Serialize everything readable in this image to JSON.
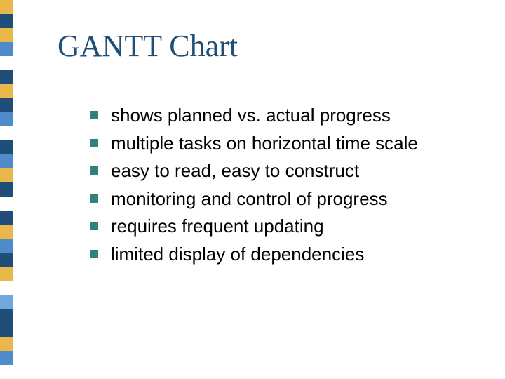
{
  "title": "GANTT Chart",
  "bullets": [
    "shows planned vs. actual progress",
    "multiple tasks on horizontal time scale",
    "easy to read, easy to construct",
    "monitoring and control of progress",
    "requires frequent updating",
    "limited display of dependencies"
  ],
  "sidebar_colors": [
    "#e8b94a",
    "#1f4e79",
    "#e8b94a",
    "#4f8bc9",
    "#ffffff",
    "#1f4e79",
    "#e8b94a",
    "#1f4e79",
    "#4f8bc9",
    "#ffffff",
    "#1f4e79",
    "#4f8bc9",
    "#e8b94a",
    "#1f4e79",
    "#ffffff",
    "#1f4e79",
    "#e8b94a",
    "#4f8bc9",
    "#1f4e79",
    "#e8b94a",
    "#ffffff",
    "#6fa8dc",
    "#1f4e79",
    "#1f4e79",
    "#e8b94a",
    "#4f8bc9",
    "#ffffff"
  ]
}
